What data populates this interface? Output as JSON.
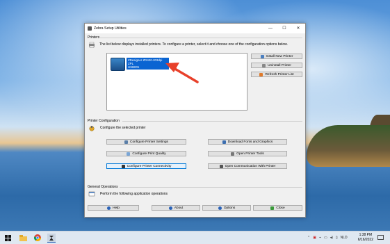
{
  "window": {
    "title": "Zebra Setup Utilities",
    "controls": {
      "minimize": "—",
      "maximize": "☐",
      "close": "✕"
    }
  },
  "printers_section": {
    "label": "Printers",
    "description": "The list below displays installed printers. To configure a printer, select it and choose one of the configuration options below.",
    "printer_name": "ZDesigner ZD420-203dpi ZPL",
    "printer_port": "USB001",
    "buttons": {
      "install": "Install New Printer",
      "uninstall": "Uninstall Printer",
      "refresh": "Refresh Printer List"
    }
  },
  "config_section": {
    "label": "Printer Configuration",
    "description": "Configure the selected printer",
    "buttons": {
      "settings": "Configure Printer Settings",
      "quality": "Configure Print Quality",
      "connectivity": "Configure Printer Connectivity",
      "fonts": "Download Fonts and Graphics",
      "tools": "Open Printer Tools",
      "communication": "Open Communication With Printer"
    }
  },
  "general_section": {
    "label": "General Operations",
    "description": "Perform the following application operations",
    "buttons": {
      "help": "Help",
      "about": "About",
      "options": "Options",
      "close": "Close"
    }
  },
  "taskbar": {
    "time": "1:38 PM",
    "date": "6/16/2022",
    "language": "NLD"
  },
  "colors": {
    "selection": "#0a64d2",
    "arrow": "#e8402a",
    "focus_border": "#0078d7"
  }
}
